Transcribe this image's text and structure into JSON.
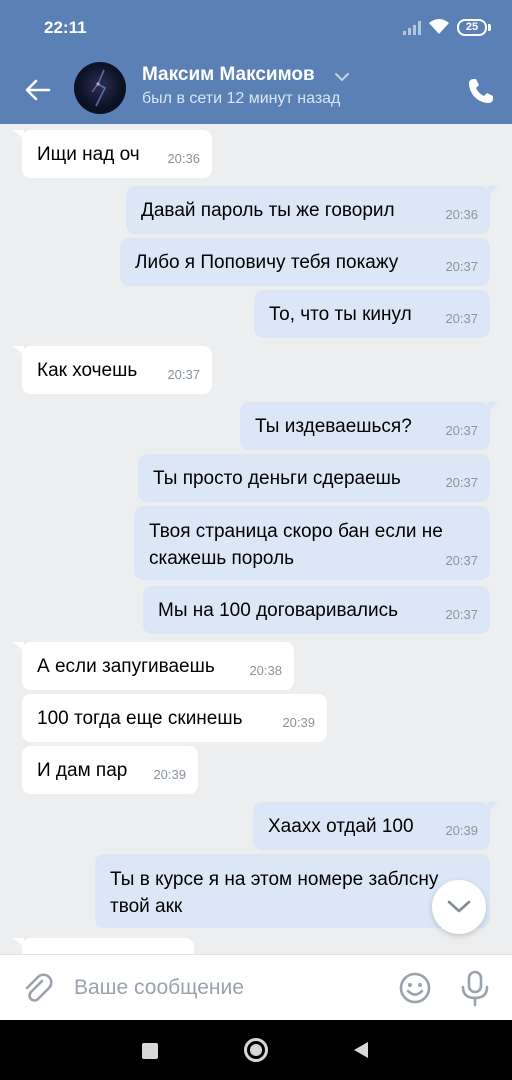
{
  "status_bar": {
    "time": "22:11",
    "battery": "25"
  },
  "header": {
    "contact_name": "Максим Максимов",
    "contact_status": "был в сети 12 минут назад"
  },
  "messages": [
    {
      "direction": "in",
      "text": "Ищи над оч",
      "time": "20:36"
    },
    {
      "direction": "out",
      "text": "Давай пароль ты же говорил",
      "time": "20:36"
    },
    {
      "direction": "out",
      "text": "Либо я Поповичу тебя покажу",
      "time": "20:37"
    },
    {
      "direction": "out",
      "text": "То, что ты кинул",
      "time": "20:37"
    },
    {
      "direction": "in",
      "text": "Как хочешь",
      "time": "20:37"
    },
    {
      "direction": "out",
      "text": "Ты издеваешься?",
      "time": "20:37"
    },
    {
      "direction": "out",
      "text": "Ты просто деньги сдераешь",
      "time": "20:37"
    },
    {
      "direction": "out",
      "line1": "Твоя страница скоро бан если не",
      "line2": "скажешь пороль",
      "time": "20:37"
    },
    {
      "direction": "out",
      "text": "Мы на 100 договаривались",
      "time": "20:37"
    },
    {
      "direction": "in",
      "text": "А если запугиваешь",
      "time": "20:38"
    },
    {
      "direction": "in",
      "text": "100 тогда еще скинешь",
      "time": "20:39"
    },
    {
      "direction": "in",
      "text": "И дам пар",
      "time": "20:39"
    },
    {
      "direction": "out",
      "text": "Хааxх отдай 100",
      "time": "20:39"
    },
    {
      "direction": "out",
      "line1": "Ты в курсе я на этом номере заблсну",
      "line2": "твой акк",
      "time": ""
    }
  ],
  "composer": {
    "placeholder": "Ваше сообщение"
  },
  "colors": {
    "header_bg": "#5a80b5",
    "chat_bg": "#edeef0",
    "outgoing_bubble": "#dbe7f7",
    "incoming_bubble": "#ffffff",
    "icon_gray": "#99a2ad"
  },
  "icons": [
    "back-arrow-icon",
    "chevron-down-icon",
    "phone-icon",
    "chevron-down-icon",
    "paperclip-icon",
    "smiley-icon",
    "microphone-icon",
    "nav-recents-icon",
    "nav-home-icon",
    "nav-back-icon"
  ]
}
